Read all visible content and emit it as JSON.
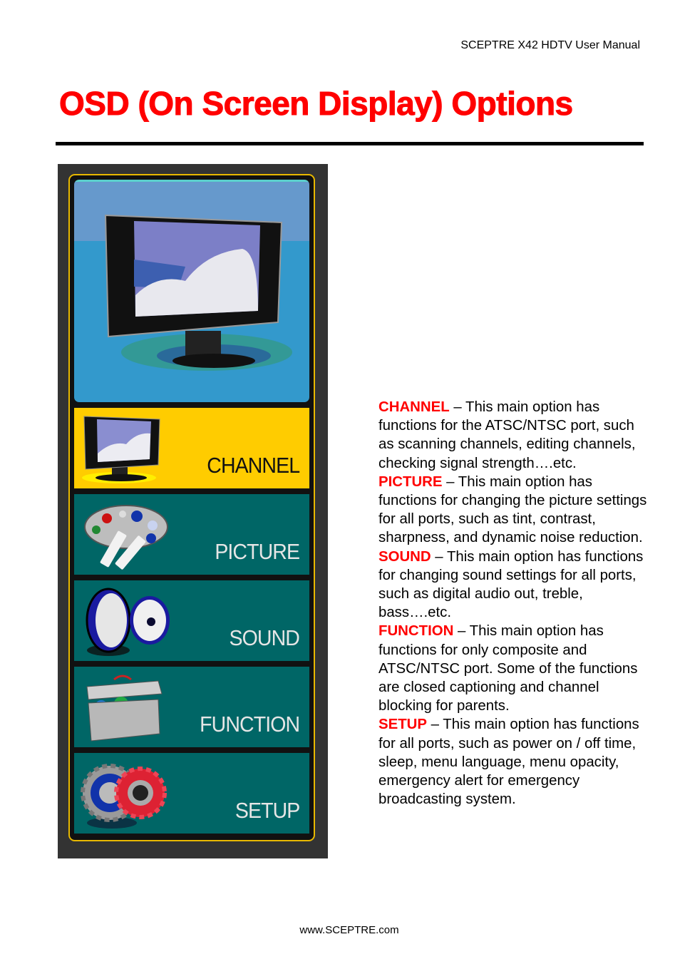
{
  "header": {
    "running_title": "SCEPTRE X42 HDTV User Manual"
  },
  "page": {
    "title": "OSD (On Screen Display) Options"
  },
  "osd_menu": {
    "preview_icon": "flat-screen-tv-icon",
    "items": [
      {
        "label": "CHANNEL",
        "icon": "tv-icon",
        "selected": true
      },
      {
        "label": "PICTURE",
        "icon": "paint-palette-icon",
        "selected": false
      },
      {
        "label": "SOUND",
        "icon": "speaker-icon",
        "selected": false
      },
      {
        "label": "FUNCTION",
        "icon": "toolbox-icon",
        "selected": false
      },
      {
        "label": "SETUP",
        "icon": "gears-icon",
        "selected": false
      }
    ],
    "colors": {
      "frame": "#e8b800",
      "selected_tile": "#ffcc00",
      "tile": "#006666",
      "panel": "#333333"
    }
  },
  "descriptions": [
    {
      "keyword": "CHANNEL",
      "text": " – This main option has functions for the ATSC/NTSC port, such as scanning channels, editing channels, checking signal strength….etc."
    },
    {
      "keyword": "PICTURE",
      "text": " – This main option has functions for changing the picture settings for all ports, such as tint, contrast, sharpness, and dynamic noise reduction."
    },
    {
      "keyword": "SOUND",
      "text": " – This main option has functions for changing sound settings for all ports, such as digital audio out, treble, bass….etc."
    },
    {
      "keyword": "FUNCTION",
      "text": " – This main option has functions for only composite and ATSC/NTSC port.  Some of the functions are closed captioning and channel blocking for parents."
    },
    {
      "keyword": "SETUP",
      "text": " – This main option has functions for all ports, such as power on / off time, sleep, menu language, menu opacity, emergency alert for emergency broadcasting system."
    }
  ],
  "footer": {
    "url": "www.SCEPTRE.com"
  }
}
